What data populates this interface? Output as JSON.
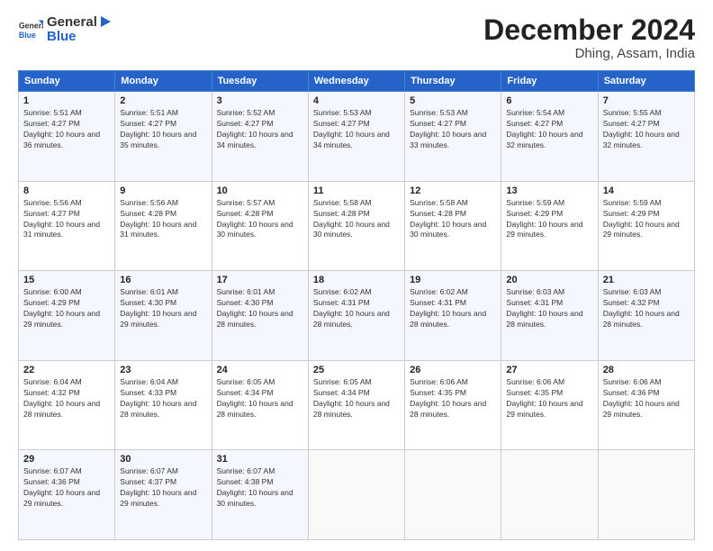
{
  "logo": {
    "general": "General",
    "blue": "Blue"
  },
  "header": {
    "month": "December 2024",
    "location": "Dhing, Assam, India"
  },
  "weekdays": [
    "Sunday",
    "Monday",
    "Tuesday",
    "Wednesday",
    "Thursday",
    "Friday",
    "Saturday"
  ],
  "weeks": [
    [
      {
        "day": "1",
        "sunrise": "5:51 AM",
        "sunset": "4:27 PM",
        "daylight": "10 hours and 36 minutes."
      },
      {
        "day": "2",
        "sunrise": "5:51 AM",
        "sunset": "4:27 PM",
        "daylight": "10 hours and 35 minutes."
      },
      {
        "day": "3",
        "sunrise": "5:52 AM",
        "sunset": "4:27 PM",
        "daylight": "10 hours and 34 minutes."
      },
      {
        "day": "4",
        "sunrise": "5:53 AM",
        "sunset": "4:27 PM",
        "daylight": "10 hours and 34 minutes."
      },
      {
        "day": "5",
        "sunrise": "5:53 AM",
        "sunset": "4:27 PM",
        "daylight": "10 hours and 33 minutes."
      },
      {
        "day": "6",
        "sunrise": "5:54 AM",
        "sunset": "4:27 PM",
        "daylight": "10 hours and 32 minutes."
      },
      {
        "day": "7",
        "sunrise": "5:55 AM",
        "sunset": "4:27 PM",
        "daylight": "10 hours and 32 minutes."
      }
    ],
    [
      {
        "day": "8",
        "sunrise": "5:56 AM",
        "sunset": "4:27 PM",
        "daylight": "10 hours and 31 minutes."
      },
      {
        "day": "9",
        "sunrise": "5:56 AM",
        "sunset": "4:28 PM",
        "daylight": "10 hours and 31 minutes."
      },
      {
        "day": "10",
        "sunrise": "5:57 AM",
        "sunset": "4:28 PM",
        "daylight": "10 hours and 30 minutes."
      },
      {
        "day": "11",
        "sunrise": "5:58 AM",
        "sunset": "4:28 PM",
        "daylight": "10 hours and 30 minutes."
      },
      {
        "day": "12",
        "sunrise": "5:58 AM",
        "sunset": "4:28 PM",
        "daylight": "10 hours and 30 minutes."
      },
      {
        "day": "13",
        "sunrise": "5:59 AM",
        "sunset": "4:29 PM",
        "daylight": "10 hours and 29 minutes."
      },
      {
        "day": "14",
        "sunrise": "5:59 AM",
        "sunset": "4:29 PM",
        "daylight": "10 hours and 29 minutes."
      }
    ],
    [
      {
        "day": "15",
        "sunrise": "6:00 AM",
        "sunset": "4:29 PM",
        "daylight": "10 hours and 29 minutes."
      },
      {
        "day": "16",
        "sunrise": "6:01 AM",
        "sunset": "4:30 PM",
        "daylight": "10 hours and 29 minutes."
      },
      {
        "day": "17",
        "sunrise": "6:01 AM",
        "sunset": "4:30 PM",
        "daylight": "10 hours and 28 minutes."
      },
      {
        "day": "18",
        "sunrise": "6:02 AM",
        "sunset": "4:31 PM",
        "daylight": "10 hours and 28 minutes."
      },
      {
        "day": "19",
        "sunrise": "6:02 AM",
        "sunset": "4:31 PM",
        "daylight": "10 hours and 28 minutes."
      },
      {
        "day": "20",
        "sunrise": "6:03 AM",
        "sunset": "4:31 PM",
        "daylight": "10 hours and 28 minutes."
      },
      {
        "day": "21",
        "sunrise": "6:03 AM",
        "sunset": "4:32 PM",
        "daylight": "10 hours and 28 minutes."
      }
    ],
    [
      {
        "day": "22",
        "sunrise": "6:04 AM",
        "sunset": "4:32 PM",
        "daylight": "10 hours and 28 minutes."
      },
      {
        "day": "23",
        "sunrise": "6:04 AM",
        "sunset": "4:33 PM",
        "daylight": "10 hours and 28 minutes."
      },
      {
        "day": "24",
        "sunrise": "6:05 AM",
        "sunset": "4:34 PM",
        "daylight": "10 hours and 28 minutes."
      },
      {
        "day": "25",
        "sunrise": "6:05 AM",
        "sunset": "4:34 PM",
        "daylight": "10 hours and 28 minutes."
      },
      {
        "day": "26",
        "sunrise": "6:06 AM",
        "sunset": "4:35 PM",
        "daylight": "10 hours and 28 minutes."
      },
      {
        "day": "27",
        "sunrise": "6:06 AM",
        "sunset": "4:35 PM",
        "daylight": "10 hours and 29 minutes."
      },
      {
        "day": "28",
        "sunrise": "6:06 AM",
        "sunset": "4:36 PM",
        "daylight": "10 hours and 29 minutes."
      }
    ],
    [
      {
        "day": "29",
        "sunrise": "6:07 AM",
        "sunset": "4:36 PM",
        "daylight": "10 hours and 29 minutes."
      },
      {
        "day": "30",
        "sunrise": "6:07 AM",
        "sunset": "4:37 PM",
        "daylight": "10 hours and 29 minutes."
      },
      {
        "day": "31",
        "sunrise": "6:07 AM",
        "sunset": "4:38 PM",
        "daylight": "10 hours and 30 minutes."
      },
      null,
      null,
      null,
      null
    ]
  ],
  "labels": {
    "sunrise": "Sunrise:",
    "sunset": "Sunset:",
    "daylight": "Daylight:"
  }
}
